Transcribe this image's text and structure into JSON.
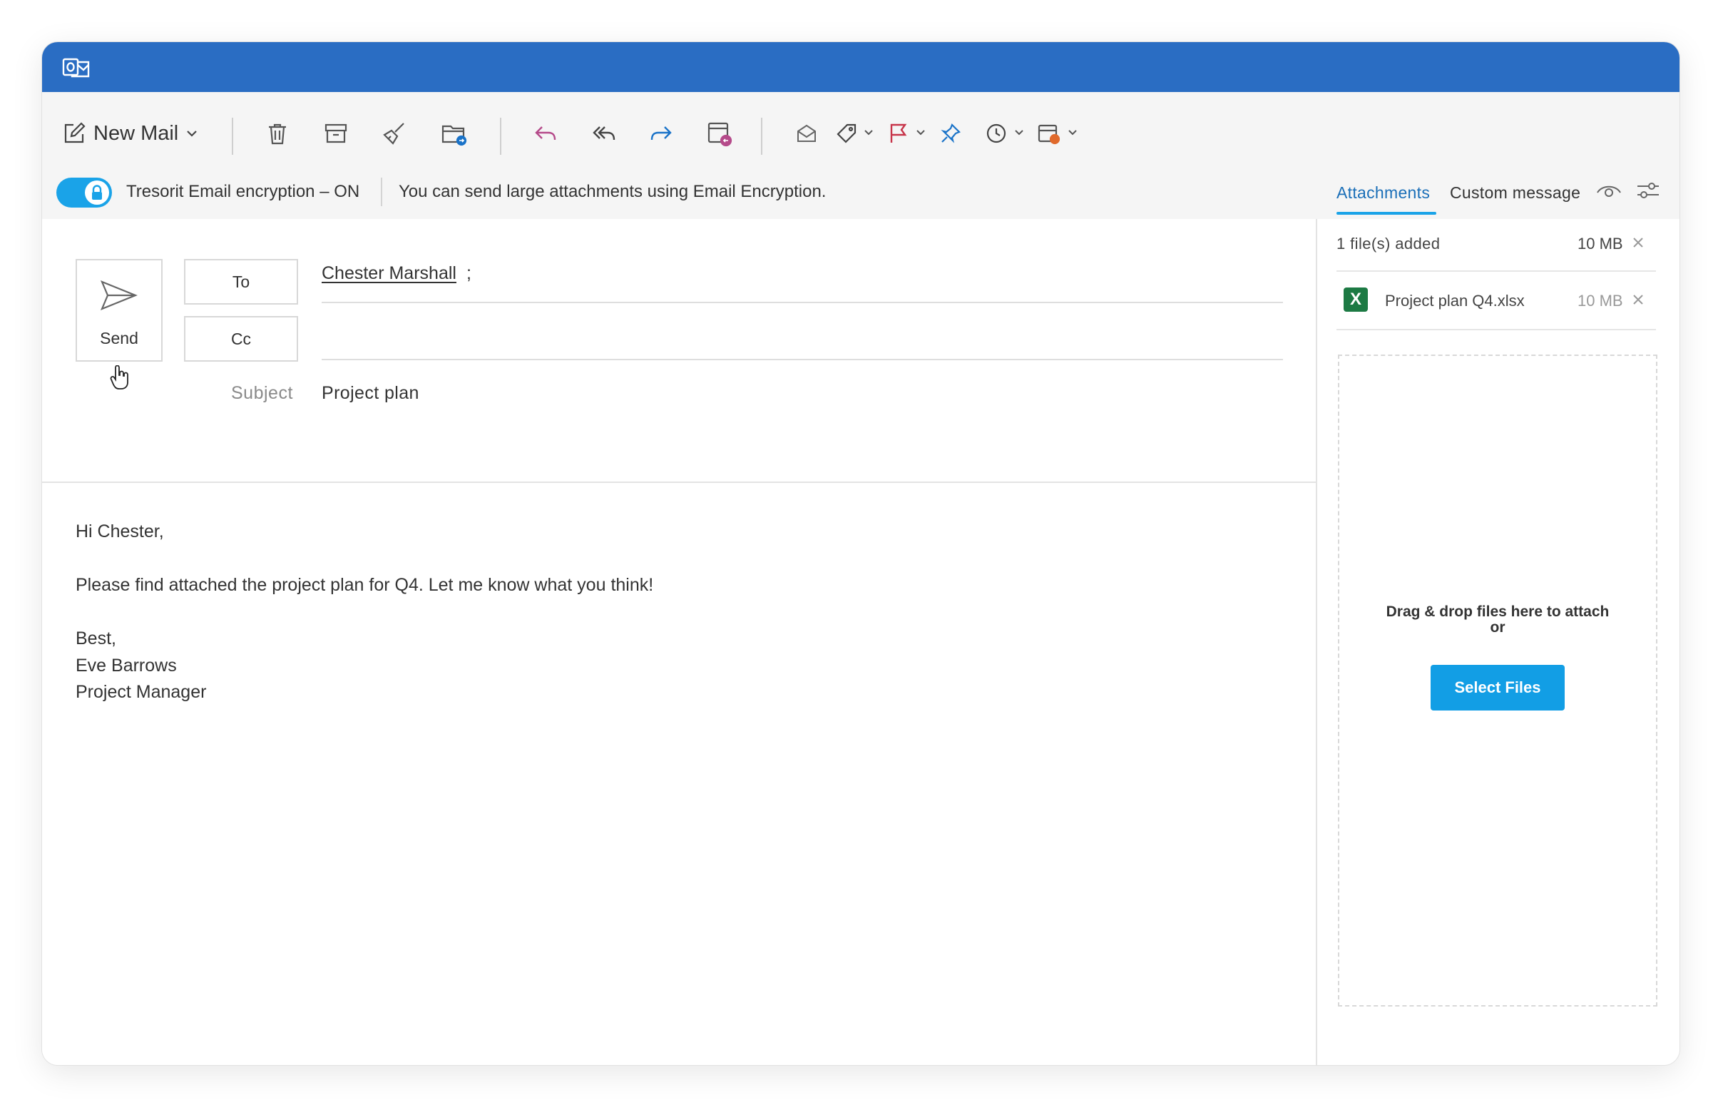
{
  "toolbar": {
    "new_mail_label": "New Mail"
  },
  "encryption": {
    "status_label": "Tresorit Email encryption – ON",
    "info_text": "You can send large attachments using Email Encryption.",
    "enabled": true
  },
  "tabs": [
    {
      "label": "Attachments",
      "active": true
    },
    {
      "label": "Custom message",
      "active": false
    }
  ],
  "compose": {
    "send_label": "Send",
    "to_label": "To",
    "cc_label": "Cc",
    "to_recipient": "Chester Marshall",
    "recipient_separator": ";",
    "subject_label": "Subject",
    "subject_value": "Project plan",
    "body": "Hi Chester,\n\nPlease find attached the project plan for Q4. Let me know what you think!\n\nBest,\nEve Barrows\nProject Manager"
  },
  "attachments": {
    "summary": "1 file(s) added",
    "total_size": "10 MB",
    "files": [
      {
        "name": "Project plan Q4.xlsx",
        "size": "10 MB",
        "icon": "excel-icon"
      }
    ],
    "drop_text_line1": "Drag & drop files here to attach",
    "drop_text_line2": "or",
    "select_button": "Select Files"
  },
  "colors": {
    "title_bar": "#2a6dc3",
    "accent": "#1aa3e8",
    "select_button": "#129ee5",
    "excel_green": "#1d7a44"
  }
}
